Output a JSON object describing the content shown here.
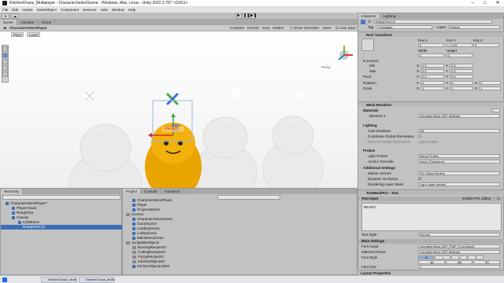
{
  "window": {
    "title": "KitchenChaos_Multiplayer - CharacterSelectScene - Windows, Mac, Linux - Unity 2022.2.7f1* <DX11>"
  },
  "menu": [
    "File",
    "Edit",
    "Assets",
    "GameObject",
    "Component",
    "Services",
    "Jobs",
    "Window",
    "Help"
  ],
  "toolbar": {
    "layers": "Layers",
    "layout": "Layout"
  },
  "scene_tabs": [
    "Scene",
    "Animator",
    "Game"
  ],
  "scene_toolbar": {
    "breadcrumb": "CharacterSelectPlayer",
    "context": "Contexts:",
    "normal": "Normal",
    "grey": "Grey",
    "hidden": "Hidden",
    "show_overrides": "Show Overrides",
    "save": "Save",
    "auto_save": "Auto Save",
    "pivot": "Pivot",
    "space": "Local"
  },
  "gizmo_label": "Persp",
  "viewport": {
    "labels": [
      "READY",
      "READY",
      "READY",
      "READY"
    ]
  },
  "hierarchy": {
    "tabs": [
      "Hierarchy"
    ],
    "rows": [
      {
        "label": "CharacterSelectPlayer*",
        "depth": 0
      },
      {
        "label": "PlayerVisual",
        "depth": 1
      },
      {
        "label": "ReadyText",
        "depth": 1
      },
      {
        "label": "Canvas",
        "depth": 1
      },
      {
        "label": "KickButton",
        "depth": 2
      },
      {
        "label": "ReadyText (1)",
        "depth": 2
      }
    ]
  },
  "project": {
    "tabs": [
      "Project",
      "Console",
      "Animation"
    ],
    "tree": [
      "CharacterSelectPlayer",
      "Player",
      "ProgressBarUI",
      "Scenes",
      "CharacterSelectScene",
      "GameScene",
      "LoadingScene",
      "LobbyScene",
      "MainMenuScene",
      "ScriptableObjects",
      "BurningRecipeSO",
      "CuttingRecipeSO",
      "FryingRecipeSO",
      "KitchenObjectSO",
      "KitchenObjectListSO"
    ]
  },
  "inspector": {
    "tabs": [
      "Inspector",
      "Lighting"
    ],
    "object_name": "ReadyText (1)",
    "tag_label": "Tag",
    "tag_value": "Untagged",
    "layer_label": "Layer",
    "layer_value": "Default",
    "rect_transform": "Rect Transform",
    "pos_headers": [
      "Pos X",
      "Pos Y",
      "Pos Z"
    ],
    "pos_values": [
      "0",
      "-1.125",
      "0"
    ],
    "size_headers": [
      "Width",
      "Height"
    ],
    "size_values": [
      "2",
      "2"
    ],
    "anchors": "Anchors",
    "min": "Min",
    "max": "Max",
    "pivot": "Pivot",
    "min_values": [
      "0.5",
      "0.5"
    ],
    "max_values": [
      "0.5",
      "0.5"
    ],
    "pivot_values": [
      "0.5",
      "0.5"
    ],
    "rotation": "Rotation",
    "rotation_values": [
      "0",
      "0",
      "0"
    ],
    "scale": "Scale",
    "scale_values": [
      "1",
      "1",
      "1"
    ],
    "mesh_renderer": "Mesh Renderer",
    "materials": "Materials",
    "materials_count": "1",
    "element0": "Element 0",
    "element0_value": "LiberationSans SDF Material",
    "lighting": "Lighting",
    "cast_shadows": "Cast Shadows",
    "cast_shadows_value": "Off",
    "contribute_gi": "Contribute Global Illumination",
    "receive_gi": "Receive Global Illumination",
    "receive_gi_value": "Light Probes",
    "probes": "Probes",
    "light_probes": "Light Probes",
    "light_probes_value": "Blend Probes",
    "anchor_override": "Anchor Override",
    "anchor_override_value": "None (Transform)",
    "additional": "Additional Settings",
    "motion_vectors": "Motion Vectors",
    "motion_vectors_value": "Per Object Motion",
    "dynamic_occlusion": "Dynamic Occlusion",
    "rendering_layer": "Rendering Layer Mask",
    "rendering_layer_value": "Light Layer default",
    "tmp": "TextMeshPro - Text",
    "text_input": "Text Input",
    "enable_rtl": "Enable RTL Editor",
    "text_value": "READY",
    "text_style": "Text Style",
    "text_style_value": "Normal",
    "main_settings": "Main Settings",
    "font_asset": "Font Asset",
    "font_asset_value": "LiberationSans SDF (TMP_Font Asset)",
    "material_preset": "Material Preset",
    "material_preset_value": "LiberationSans SDF Material",
    "font_style": "Font Style",
    "font_style_buttons": [
      "B",
      "I",
      "U",
      "S"
    ],
    "font_style_buttons2": [
      "ab",
      "AB",
      "SC"
    ],
    "font_size": "Font Size",
    "font_size_value": "1",
    "auto_size": "Auto Size",
    "layout_props": "Layout Properties"
  },
  "taskbar": {
    "apps": [
      "KitchenChaos_Multipla...",
      "KitchenChaos_Multipla..."
    ]
  },
  "colors": {
    "accent": "#3e6fb7",
    "player_yellow": "#f0a800",
    "ghost_white": "#e8e8e8"
  }
}
